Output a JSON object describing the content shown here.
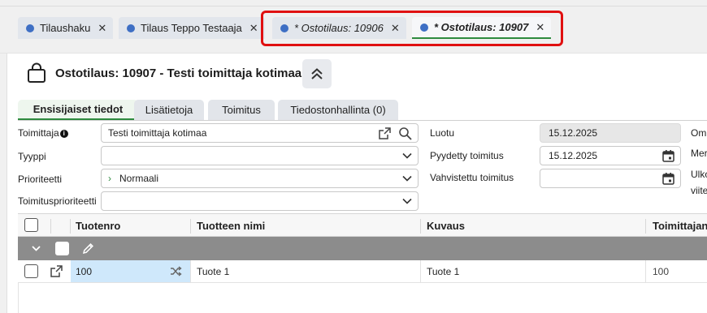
{
  "tabs": [
    {
      "label": "Tilaushaku",
      "close": "✕"
    },
    {
      "label": "Tilaus Teppo Testaaja",
      "close": "✕"
    },
    {
      "label": "* Ostotilaus: 10906",
      "close": "✕"
    },
    {
      "label": "* Ostotilaus: 10907",
      "close": "✕",
      "active": true
    }
  ],
  "header": {
    "title": "Ostotilaus: 10907 - Testi toimittaja kotimaa",
    "collapse_icon": "double-chevron-up-icon"
  },
  "subtabs": [
    {
      "label": "Ensisijaiset tiedot",
      "active": true
    },
    {
      "label": "Lisätietoja"
    },
    {
      "label": "Toimitus"
    },
    {
      "label": "Tiedostonhallinta (0)"
    }
  ],
  "form_left": {
    "supplier_label": "Toimittaja",
    "supplier_info": "i",
    "supplier_value": "Testi toimittaja kotimaa",
    "type_label": "Tyyppi",
    "type_value": "",
    "priority_label": "Prioriteetti",
    "priority_chevron": "›",
    "priority_value": "Normaali",
    "delivery_priority_label": "Toimitusprioriteetti",
    "delivery_priority_value": ""
  },
  "form_right": {
    "created_label": "Luotu",
    "created_value": "15.12.2025",
    "requested_label": "Pyydetty toimitus",
    "requested_value": "15.12.2025",
    "confirmed_label": "Vahvistettu toimitus",
    "confirmed_value": ""
  },
  "form_far_right": {
    "label1": "Om",
    "label2": "Mer",
    "label3a": "Ulko",
    "label3b": "viite"
  },
  "table": {
    "columns": [
      "Tuotenro",
      "Tuotteen nimi",
      "Kuvaus",
      "Toimittajan"
    ],
    "rows": [
      {
        "product_no": "100",
        "product_name": "Tuote 1",
        "description": "Tuote 1",
        "supplier_no": "100"
      }
    ]
  },
  "colors": {
    "accent_green": "#2e8b3e",
    "tab_dot_blue": "#3e6fc4",
    "highlight_red": "#e01010",
    "selected_cell": "#cfe8fb"
  }
}
